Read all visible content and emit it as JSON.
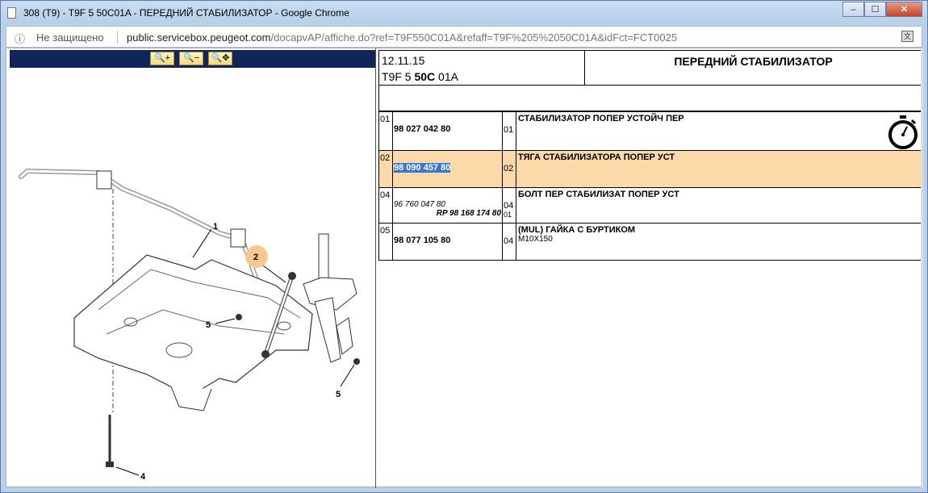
{
  "window": {
    "title": "308 (T9) - T9F 5 50C01A - ПЕРЕДНИЙ СТАБИЛИЗАТОР - Google Chrome",
    "minimize": "‒",
    "maximize": "☐",
    "close": "✕"
  },
  "address": {
    "security_label": "Не защищено",
    "url_host": "public.servicebox.peugeot.com",
    "url_rest": "/docapvAP/affiche.do?ref=T9F550C01A&refaff=T9F%205%2050C01A&idFct=FCT0025"
  },
  "zoom_toolbar": {
    "zoom_in": "🔍+",
    "zoom_out": "🔍−",
    "zoom_pan": "🔍✥"
  },
  "diagram": {
    "callouts": [
      "1",
      "2",
      "5",
      "5",
      "4"
    ]
  },
  "header": {
    "date": "12.11.15",
    "code_prefix": "T9F 5 ",
    "code_bold": "50C",
    "code_suffix": " 01A",
    "title": "ПЕРЕДНИЙ СТАБИЛИЗАТОР"
  },
  "parts": [
    {
      "num": "01",
      "ref": "98 027 042 80",
      "qty": "01",
      "desc": "СТАБИЛИЗАТОР ПОПЕР УСТОЙЧ ПЕР",
      "sub": ""
    },
    {
      "num": "02",
      "ref": "98 090 457 80",
      "qty": "02",
      "desc": "ТЯГА СТАБИЛИЗАТОРА ПОПЕР УСТ",
      "sub": ""
    },
    {
      "num": "04",
      "ref": "96 760 047 80",
      "ref_rp": "RP 98 168 174 80",
      "qty": "04",
      "qty2": "01",
      "desc": "БОЛТ ПЕР СТАБИЛИЗАТ ПОПЕР УСТ",
      "sub": ""
    },
    {
      "num": "05",
      "ref": "98 077 105 80",
      "qty": "04",
      "desc": "(MUL) ГАЙКА С БУРТИКОМ",
      "sub": "M10X150"
    }
  ]
}
